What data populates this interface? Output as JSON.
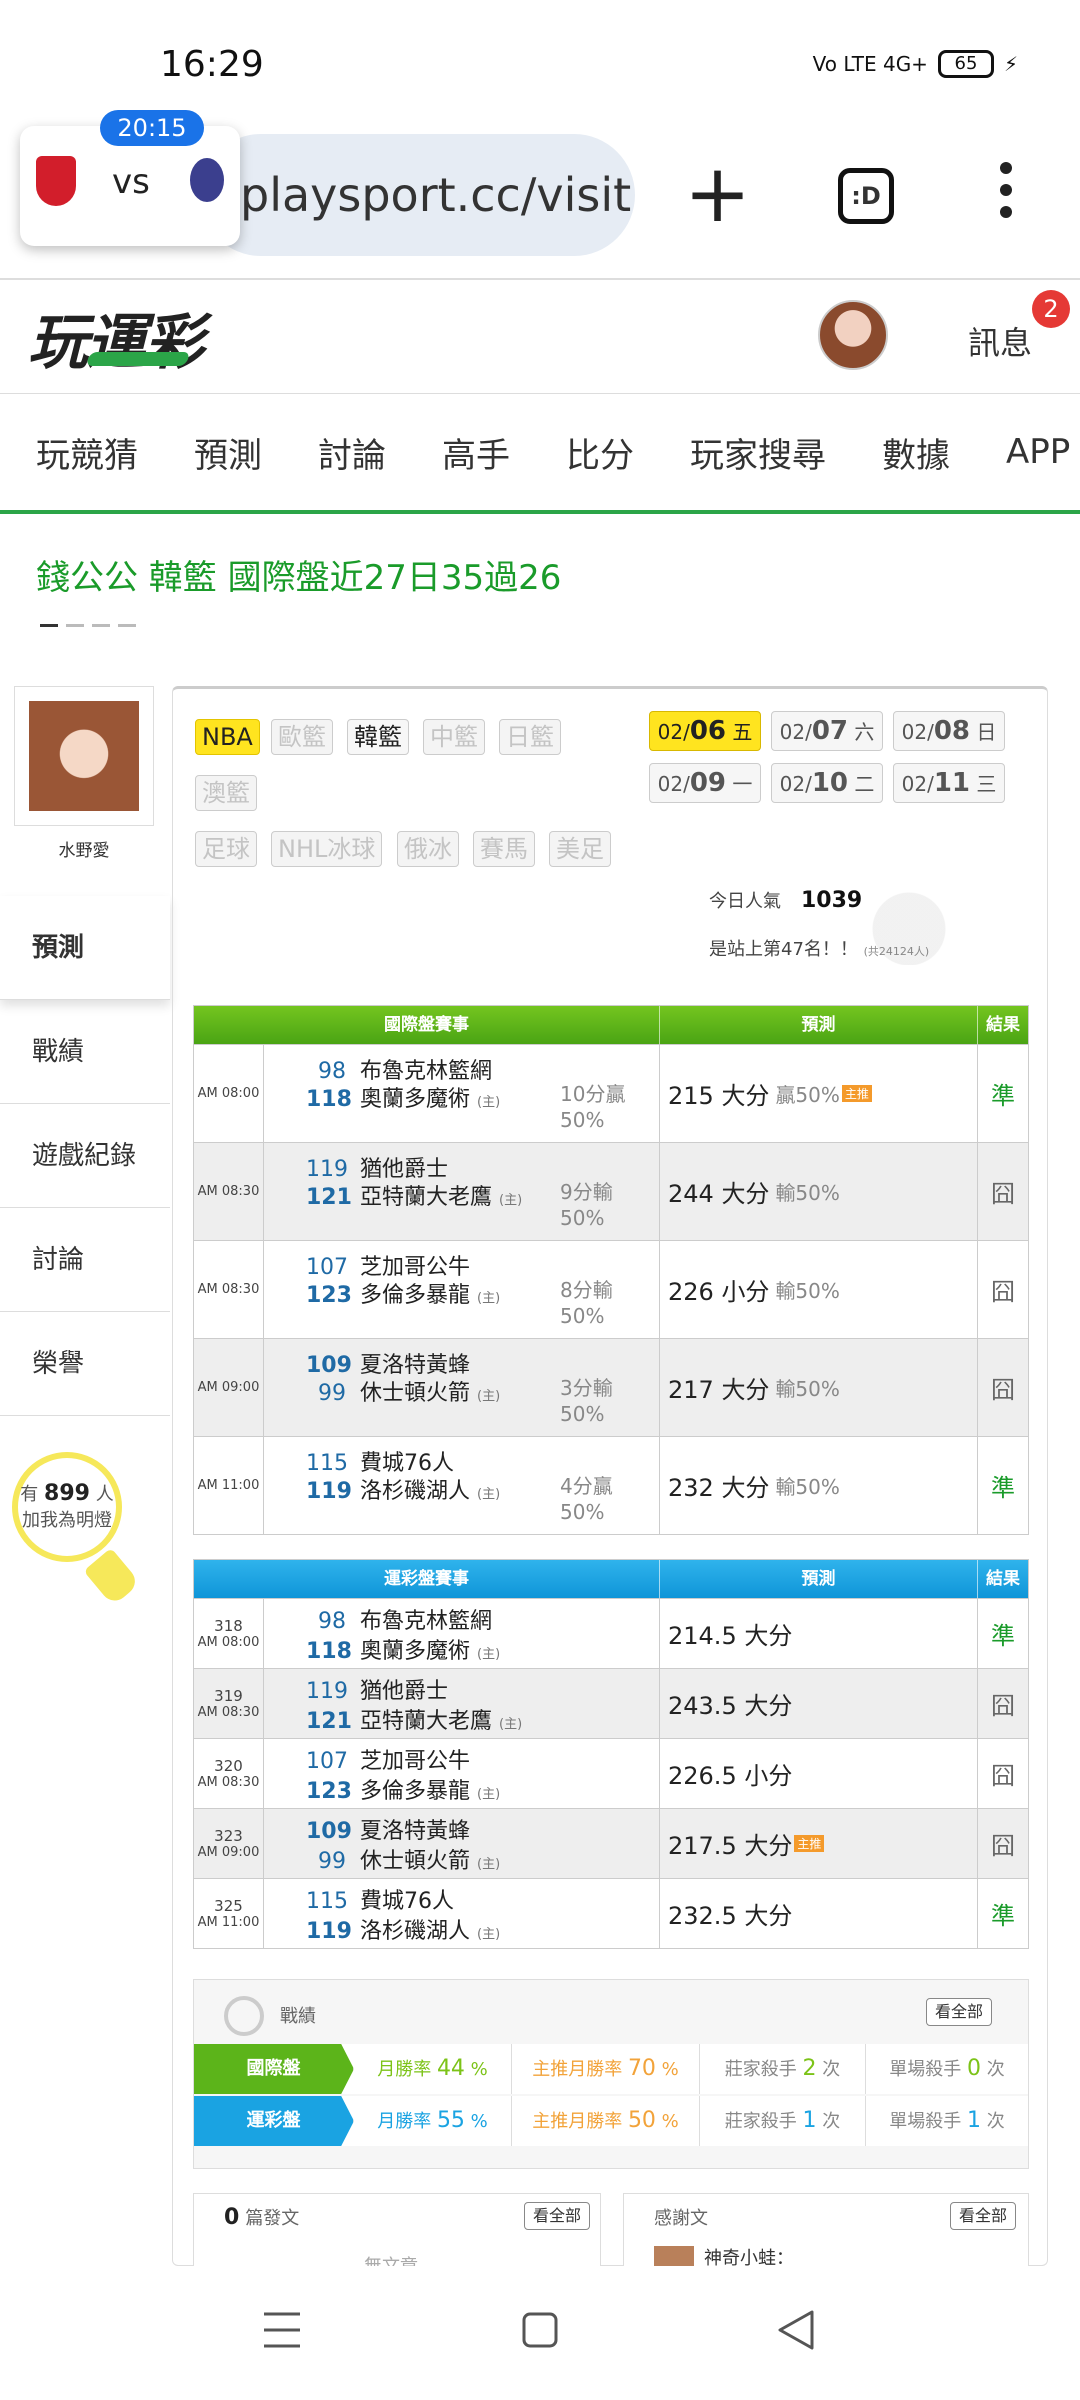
{
  "status_bar": {
    "time": "16:29",
    "network": "Vo LTE 4G+",
    "battery": "65"
  },
  "browser": {
    "url": "playsport.cc/visit",
    "tab_count_label": ":D",
    "live_score": {
      "time": "20:15",
      "vs": "vs"
    }
  },
  "site": {
    "logo": "玩運彩",
    "messages_label": "訊息",
    "messages_badge": "2",
    "nav": [
      "玩競猜",
      "預測",
      "討論",
      "高手",
      "比分",
      "玩家搜尋",
      "數據",
      "APP"
    ]
  },
  "page": {
    "title": "錢公公 韓籃 國際盤近27日35過26"
  },
  "sidebar": {
    "username": "水野愛",
    "items": [
      "預測",
      "戰績",
      "遊戲紀錄",
      "討論",
      "榮譽"
    ],
    "fans_prefix": "有",
    "fans_count": "899",
    "fans_suffix": "人",
    "fans_action": "加我為明燈"
  },
  "leagues": {
    "row1": [
      "NBA",
      "歐籃",
      "韓籃",
      "中籃",
      "日籃"
    ],
    "row2": [
      "澳籃"
    ],
    "row3": [
      "足球",
      "NHL冰球",
      "俄冰",
      "賽馬",
      "美足"
    ]
  },
  "dates": [
    {
      "md": "02/",
      "d": "06",
      "wd": "五"
    },
    {
      "md": "02/",
      "d": "07",
      "wd": "六"
    },
    {
      "md": "02/",
      "d": "08",
      "wd": "日"
    },
    {
      "md": "02/",
      "d": "09",
      "wd": "一"
    },
    {
      "md": "02/",
      "d": "10",
      "wd": "二"
    },
    {
      "md": "02/",
      "d": "11",
      "wd": "三"
    }
  ],
  "popularity": {
    "label": "今日人氣",
    "value": "1039",
    "rank_text": "是站上第47名！！",
    "rank_total": "(共24124人)"
  },
  "intl_table": {
    "headers": [
      "國際盤賽事",
      "預測",
      "結果"
    ],
    "rows": [
      {
        "time": "AM 08:00",
        "score1": "98",
        "team1": "布魯克林籃網",
        "score2": "118",
        "team2": "奧蘭多魔術",
        "home": "(主)",
        "spread": "10分贏",
        "spread_pct": "50%",
        "pick": "215 大分",
        "pick_pct": "贏50%",
        "hot": "主推",
        "result": "準"
      },
      {
        "time": "AM 08:30",
        "score1": "119",
        "team1": "猶他爵士",
        "score2": "121",
        "team2": "亞特蘭大老鷹",
        "home": "(主)",
        "spread": "9分輸",
        "spread_pct": "50%",
        "pick": "244 大分",
        "pick_pct": "輸50%",
        "hot": "",
        "result": "囧"
      },
      {
        "time": "AM 08:30",
        "score1": "107",
        "team1": "芝加哥公牛",
        "score2": "123",
        "team2": "多倫多暴龍",
        "home": "(主)",
        "spread": "8分輸",
        "spread_pct": "50%",
        "pick": "226 小分",
        "pick_pct": "輸50%",
        "hot": "",
        "result": "囧"
      },
      {
        "time": "AM 09:00",
        "score1": "109",
        "team1": "夏洛特黃蜂",
        "score2": "99",
        "team2": "休士頓火箭",
        "home": "(主)",
        "spread": "3分輸",
        "spread_pct": "50%",
        "pick": "217 大分",
        "pick_pct": "輸50%",
        "hot": "",
        "result": "囧"
      },
      {
        "time": "AM 11:00",
        "score1": "115",
        "team1": "費城76人",
        "score2": "119",
        "team2": "洛杉磯湖人",
        "home": "(主)",
        "spread": "4分贏",
        "spread_pct": "50%",
        "pick": "232 大分",
        "pick_pct": "輸50%",
        "hot": "",
        "result": "準"
      }
    ]
  },
  "lottery_table": {
    "headers": [
      "運彩盤賽事",
      "預測",
      "結果"
    ],
    "rows": [
      {
        "no": "318",
        "time": "AM 08:00",
        "score1": "98",
        "team1": "布魯克林籃網",
        "score2": "118",
        "team2": "奧蘭多魔術",
        "home": "(主)",
        "pick": "214.5 大分",
        "hot": "",
        "result": "準"
      },
      {
        "no": "319",
        "time": "AM 08:30",
        "score1": "119",
        "team1": "猶他爵士",
        "score2": "121",
        "team2": "亞特蘭大老鷹",
        "home": "(主)",
        "pick": "243.5 大分",
        "hot": "",
        "result": "囧"
      },
      {
        "no": "320",
        "time": "AM 08:30",
        "score1": "107",
        "team1": "芝加哥公牛",
        "score2": "123",
        "team2": "多倫多暴龍",
        "home": "(主)",
        "pick": "226.5 小分",
        "hot": "",
        "result": "囧"
      },
      {
        "no": "323",
        "time": "AM 09:00",
        "score1": "109",
        "team1": "夏洛特黃蜂",
        "score2": "99",
        "team2": "休士頓火箭",
        "home": "(主)",
        "pick": "217.5 大分",
        "hot": "主推",
        "result": "囧"
      },
      {
        "no": "325",
        "time": "AM 11:00",
        "score1": "115",
        "team1": "費城76人",
        "score2": "119",
        "team2": "洛杉磯湖人",
        "home": "(主)",
        "pick": "232.5 大分",
        "hot": "",
        "result": "準"
      }
    ]
  },
  "stats": {
    "title": "戰績",
    "more": "看全部",
    "rows": [
      {
        "label": "國際盤",
        "m1": "月勝率",
        "m1v": "44",
        "m2": "主推月勝率",
        "m2v": "70",
        "m3": "莊家殺手",
        "m3v": "2",
        "m4": "單場殺手",
        "m4v": "0",
        "pct": "%",
        "times": "次"
      },
      {
        "label": "運彩盤",
        "m1": "月勝率",
        "m1v": "55",
        "m2": "主推月勝率",
        "m2v": "50",
        "m3": "莊家殺手",
        "m3v": "1",
        "m4": "單場殺手",
        "m4v": "1",
        "pct": "%",
        "times": "次"
      }
    ]
  },
  "posts": {
    "count": "0",
    "label": "篇發文",
    "more": "看全部",
    "empty": "無文章"
  },
  "thanks": {
    "label": "感謝文",
    "more": "看全部",
    "first": "神奇小蛙："
  },
  "colors": {
    "brand_green": "#2ba548",
    "nba_yellow": "#ffe41f",
    "intl_green": "#5cb41a",
    "lottery_blue": "#1aa3e2"
  }
}
